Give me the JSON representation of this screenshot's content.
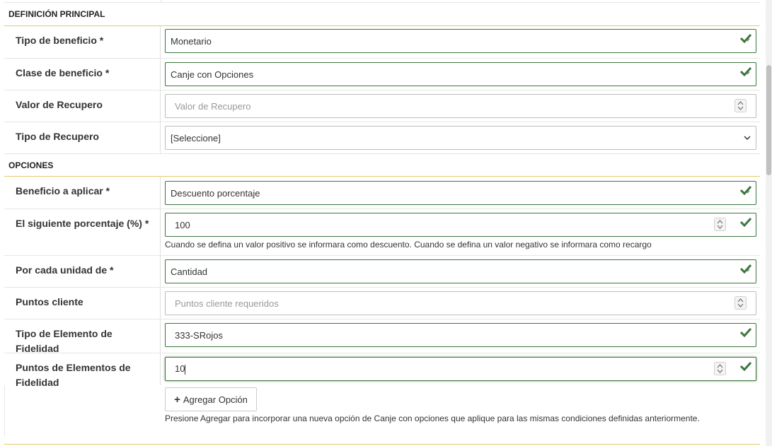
{
  "sections": {
    "principal": "DEFINICIÓN PRINCIPAL",
    "opciones": "OPCIONES"
  },
  "fields": {
    "tipo_beneficio": {
      "label": "Tipo de beneficio *",
      "value": "Monetario"
    },
    "clase_beneficio": {
      "label": "Clase de beneficio *",
      "value": "Canje con Opciones"
    },
    "valor_recupero": {
      "label": "Valor de Recupero",
      "placeholder": "Valor de Recupero"
    },
    "tipo_recupero": {
      "label": "Tipo de Recupero",
      "value": "[Seleccione]"
    },
    "beneficio_aplicar": {
      "label": "Beneficio a aplicar *",
      "value": "Descuento porcentaje"
    },
    "porcentaje": {
      "label": "El siguiente porcentaje (%) *",
      "value": "100",
      "help": "Cuando se defina un valor positivo se informara como descuento. Cuando se defina un valor negativo se informara como recargo"
    },
    "unidad": {
      "label": "Por cada unidad de *",
      "value": "Cantidad"
    },
    "puntos_cliente": {
      "label": "Puntos cliente",
      "placeholder": "Puntos cliente requeridos"
    },
    "tipo_elemento": {
      "label_line1": "Tipo de Elemento de",
      "label_line2": "Fidelidad",
      "value": "333-SRojos"
    },
    "puntos_elementos": {
      "label_line1": "Puntos de Elementos de",
      "label_line2": "Fidelidad",
      "value": "10"
    }
  },
  "add_option": {
    "label": "Agregar Opción",
    "help": "Presione Agregar para incorporar una nueva opción de Canje con opciones que aplique para las mismas condiciones definidas anteriormente."
  },
  "colors": {
    "valid": "#3c763d",
    "section_underline": "#e8c96a"
  },
  "icons": {
    "valid": "check-icon",
    "number": "spinner-icon",
    "select": "chevron-down-icon",
    "add": "plus-icon"
  }
}
